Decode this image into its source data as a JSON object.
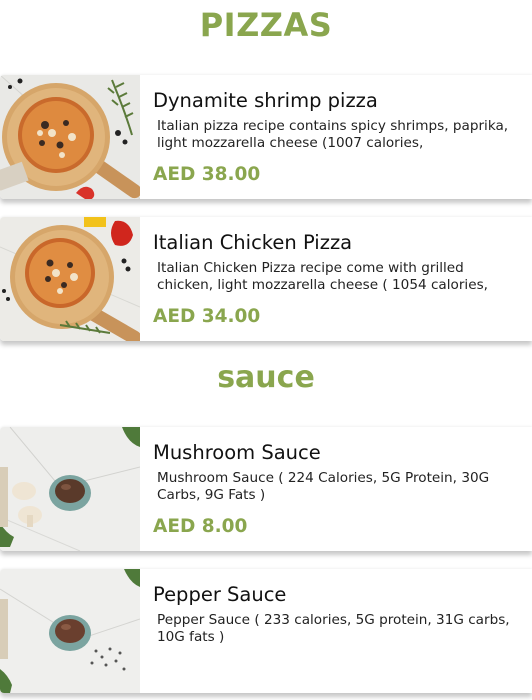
{
  "sections": {
    "pizzas_title": "PIZZAS",
    "sauce_title": "sauce"
  },
  "items": [
    {
      "name": "Dynamite shrimp pizza",
      "description": "Italian pizza recipe contains spicy shrimps, paprika, light mozzarella cheese (1007 calories,",
      "price": "AED 38.00",
      "image_icon": "pizza-photo-icon"
    },
    {
      "name": "Italian Chicken Pizza",
      "description": "Italian Chicken Pizza  recipe come with grilled chicken, light mozzarella cheese ( 1054 calories,",
      "price": "AED 34.00",
      "image_icon": "pizza-photo-icon"
    },
    {
      "name": "Mushroom Sauce",
      "description": "Mushroom Sauce ( 224 Calories, 5G Protein, 30G Carbs, 9G Fats )",
      "price": "AED 8.00",
      "image_icon": "sauce-bowl-photo-icon"
    },
    {
      "name": "Pepper Sauce",
      "description": "Pepper Sauce ( 233 calories, 5G protein, 31G carbs, 10G fats )",
      "price": "",
      "image_icon": "sauce-bowl-photo-icon"
    }
  ],
  "colors": {
    "accent": "#8aa64e"
  }
}
